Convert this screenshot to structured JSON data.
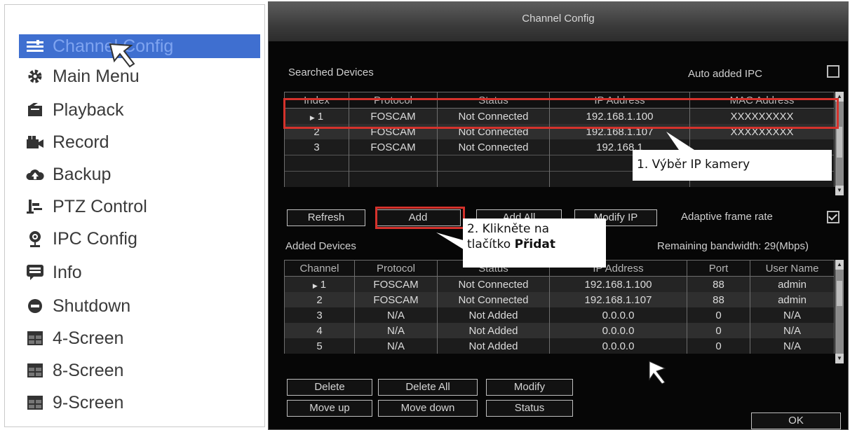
{
  "menu": {
    "items": [
      {
        "label": "Channel Config",
        "icon": "channel-config-icon",
        "selected": true
      },
      {
        "label": "Main Menu",
        "icon": "gear-icon"
      },
      {
        "label": "Playback",
        "icon": "playback-icon"
      },
      {
        "label": "Record",
        "icon": "record-icon"
      },
      {
        "label": "Backup",
        "icon": "cloud-backup-icon"
      },
      {
        "label": "PTZ Control",
        "icon": "ptz-icon"
      },
      {
        "label": "IPC Config",
        "icon": "ipc-camera-icon"
      },
      {
        "label": "Info",
        "icon": "info-icon"
      },
      {
        "label": "Shutdown",
        "icon": "shutdown-icon"
      },
      {
        "label": "4-Screen",
        "icon": "grid-icon"
      },
      {
        "label": "8-Screen",
        "icon": "grid-icon"
      },
      {
        "label": "9-Screen",
        "icon": "grid-icon"
      }
    ]
  },
  "dialog": {
    "title": "Channel Config",
    "searched": {
      "label": "Searched Devices",
      "auto_added_label": "Auto added IPC",
      "auto_added_checked": false,
      "columns": [
        "Index",
        "Protocol",
        "Status",
        "IP Address",
        "MAC Address"
      ],
      "rows": [
        [
          "1",
          "FOSCAM",
          "Not Connected",
          "192.168.1.100",
          "XXXXXXXXX"
        ],
        [
          "2",
          "FOSCAM",
          "Not Connected",
          "192.168.1.107",
          "XXXXXXXXX"
        ],
        [
          "3",
          "FOSCAM",
          "Not Connected",
          "192.168.1",
          ""
        ]
      ]
    },
    "buttons_mid": {
      "refresh": "Refresh",
      "add": "Add",
      "add_all": "Add All",
      "modify_ip": "Modify IP"
    },
    "adaptive_frame_rate": {
      "label": "Adaptive frame rate",
      "checked": true
    },
    "added": {
      "label": "Added Devices",
      "bandwidth": "Remaining bandwidth: 29(Mbps)",
      "columns": [
        "Channel",
        "Protocol",
        "Status",
        "IP Address",
        "Port",
        "User Name"
      ],
      "rows": [
        [
          "1",
          "FOSCAM",
          "Not Connected",
          "192.168.1.100",
          "88",
          "admin"
        ],
        [
          "2",
          "FOSCAM",
          "Not Connected",
          "192.168.1.107",
          "88",
          "admin"
        ],
        [
          "3",
          "N/A",
          "Not Added",
          "0.0.0.0",
          "0",
          "N/A"
        ],
        [
          "4",
          "N/A",
          "Not Added",
          "0.0.0.0",
          "0",
          "N/A"
        ],
        [
          "5",
          "N/A",
          "Not Added",
          "0.0.0.0",
          "0",
          "N/A"
        ]
      ]
    },
    "buttons_bottom": {
      "delete": "Delete",
      "delete_all": "Delete All",
      "modify": "Modify",
      "move_up": "Move up",
      "move_down": "Move down",
      "status": "Status",
      "ok": "OK"
    }
  },
  "annotations": {
    "callout1": "1. Výběr IP kamery",
    "callout2_line1": "2. Klikněte na",
    "callout2_line2_prefix": "tlačítko ",
    "callout2_line2_bold": "Přidat"
  },
  "colors": {
    "highlight": "#d5322c",
    "selected_menu_bg": "#3f6fd0"
  }
}
